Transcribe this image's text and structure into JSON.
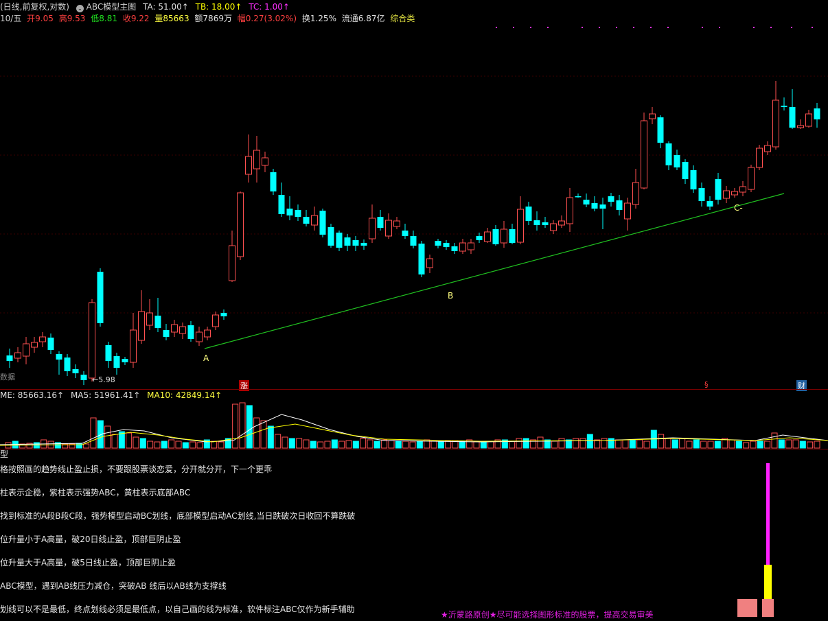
{
  "header": {
    "mode": "(日线,前复权,对数)",
    "indicator_name": "ABC模型主图",
    "ta": "TA: 51.00↑",
    "tb": "TB: 18.00↑",
    "tc": "TC: 1.00↑"
  },
  "quote": {
    "date": "10/五",
    "open": "开9.05",
    "high": "高9.53",
    "low": "低8.81",
    "close": "收9.22",
    "volume": "量85663",
    "amount": "额7869万",
    "change": "幅0.27(3.02%)",
    "turnover": "换1.25%",
    "float_cap": "流通6.87亿",
    "category": "综合类"
  },
  "chart_labels": {
    "point_a": "A",
    "point_b": "B",
    "point_c": "C-",
    "low_marker": "←5.98",
    "data_label": "数据",
    "tag_zhang": "涨",
    "tag_s": "§",
    "tag_cai": "财"
  },
  "volume_header": {
    "volume": "ME: 85663.16↑",
    "ma5": "MA5: 51961.41↑",
    "ma10": "MA10: 42849.14↑"
  },
  "sub_panel": {
    "title": "型",
    "notes": [
      "格按照画的趋势线止盈止损，不要跟股票谈恋爱，分开就分开，下一个更乖",
      "柱表示企稳，紫柱表示强势ABC，黄柱表示底部ABC",
      "找到标准的A段B段C段，强势模型启动BC划线，底部模型启动AC划线,当日跌破次日收回不算跌破",
      "位升量小于A高量，破20日线止盈，顶部巨阴止盈",
      "位升量大于A高量，破5日线止盈，顶部巨阴止盈",
      "ABC模型，遇到AB线压力减仓，突破AB 线后以AB线为支撑线",
      "划线可以不是最低，终点划线必须是最低点，以自己画的线为标准，软件标注ABC仅作为新手辅助"
    ],
    "footer": "★沂蒙路原创★尽可能选择图形标准的股票，提高交易审美"
  },
  "colors": {
    "up": "#ff5050",
    "down": "#00ffff",
    "trendline": "#20c020",
    "ma5": "#ffffff",
    "ma10": "#ffff00",
    "purple": "#ff20ff",
    "yellow": "#ffff00",
    "pink": "#f08080"
  },
  "chart_data": {
    "type": "candlestick",
    "title": "ABC模型主图",
    "scale": "log",
    "series_low_label": "5.98",
    "last_bar": {
      "open": 9.05,
      "high": 9.53,
      "low": 8.81,
      "close": 9.22,
      "volume": 85663
    },
    "volume_ma": {
      "MA5": 51961.41,
      "MA10": 42849.14
    }
  }
}
